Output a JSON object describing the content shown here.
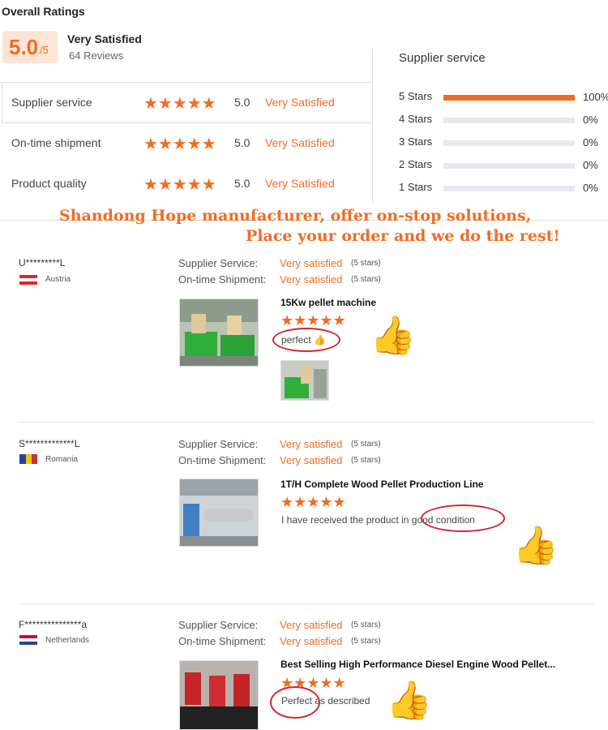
{
  "overall": {
    "title": "Overall Ratings",
    "score": "5.0",
    "score_out_of": "/5",
    "label": "Very Satisfied",
    "reviews": "64 Reviews"
  },
  "categories": [
    {
      "label": "Supplier service",
      "stars": "★★★★★",
      "score": "5.0",
      "text": "Very Satisfied"
    },
    {
      "label": "On-time shipment",
      "stars": "★★★★★",
      "score": "5.0",
      "text": "Very Satisfied"
    },
    {
      "label": "Product quality",
      "stars": "★★★★★",
      "score": "5.0",
      "text": "Very Satisfied"
    }
  ],
  "distribution": {
    "title": "Supplier service",
    "rows": [
      {
        "label": "5  Stars",
        "fraction": 1.0,
        "pct": "100%"
      },
      {
        "label": "4  Stars",
        "fraction": 0,
        "pct": "0%"
      },
      {
        "label": "3  Stars",
        "fraction": 0,
        "pct": "0%"
      },
      {
        "label": "2  Stars",
        "fraction": 0,
        "pct": "0%"
      },
      {
        "label": "1  Stars",
        "fraction": 0,
        "pct": "0%"
      }
    ]
  },
  "banner": {
    "line1": "Shandong Hope manufacturer, offer on-stop solutions,",
    "line2": "Place your order and we do the rest!"
  },
  "reviews": [
    {
      "user": "U*********L",
      "country": "Austria",
      "supplier_label": "Supplier Service:",
      "supplier_value": "Very satisfied",
      "supplier_stars": "(5 stars)",
      "shipment_label": "On-time Shipment:",
      "shipment_value": "Very satisfied",
      "shipment_stars": "(5 stars)",
      "product": "15Kw pellet machine",
      "rating_stars": "★★★★★",
      "comment": "perfect 👍"
    },
    {
      "user": "S*************L",
      "country": "Romania",
      "supplier_label": "Supplier Service:",
      "supplier_value": "Very satisfied",
      "supplier_stars": "(5 stars)",
      "shipment_label": "On-time Shipment:",
      "shipment_value": "Very satisfied",
      "shipment_stars": "(5 stars)",
      "product": "1T/H Complete Wood Pellet Production Line",
      "rating_stars": "★★★★★",
      "comment": "I have received the product in good condition"
    },
    {
      "user": "F***************a",
      "country": "Netherlands",
      "supplier_label": "Supplier Service:",
      "supplier_value": "Very satisfied",
      "supplier_stars": "(5 stars)",
      "shipment_label": "On-time Shipment:",
      "shipment_value": "Very satisfied",
      "shipment_stars": "(5 stars)",
      "product": "Best Selling High Performance Diesel Engine Wood Pellet...",
      "rating_stars": "★★★★★",
      "comment": "Perfect as described"
    }
  ],
  "colors": {
    "accent": "#f26b21",
    "circle": "#d2262d"
  },
  "icons": {
    "thumbs_up": "👍"
  }
}
